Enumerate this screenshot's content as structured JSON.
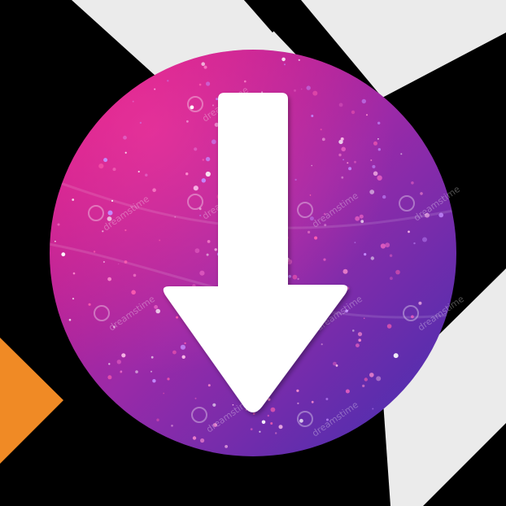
{
  "icon": {
    "name": "download-arrow-icon",
    "direction": "down"
  },
  "watermark": {
    "text": "dreamstime"
  },
  "colors": {
    "background": "#000000",
    "light_band": "#ebebeb",
    "orange_accent": "#f08a25",
    "circle_top_left": "#e0177e",
    "circle_mid": "#9a2aa8",
    "circle_bottom_right": "#3f2fb0",
    "arrow": "#ffffff"
  }
}
